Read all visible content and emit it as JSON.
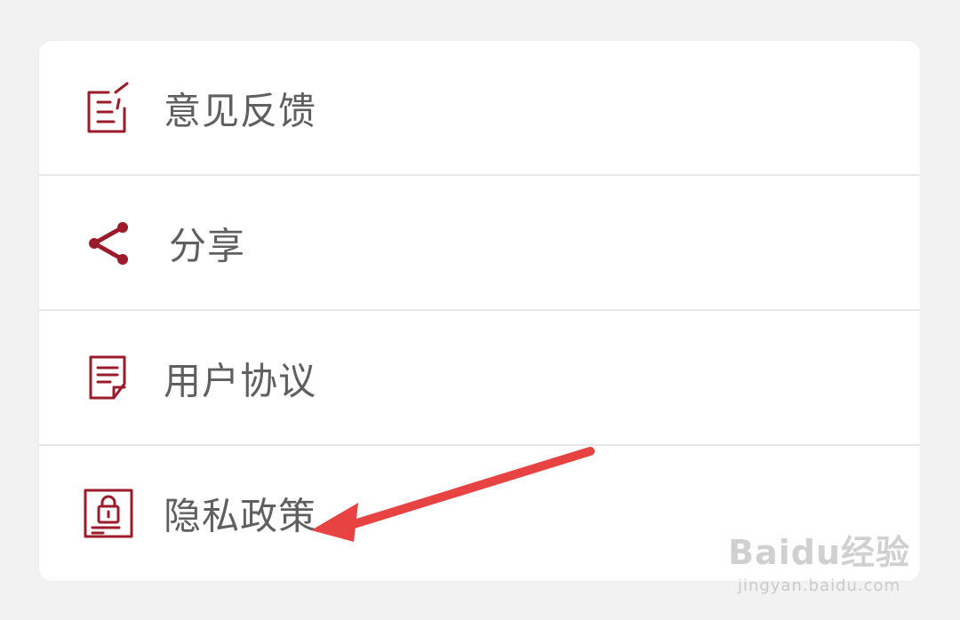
{
  "menu": {
    "items": [
      {
        "label": "意见反馈",
        "icon": "feedback-edit-icon"
      },
      {
        "label": "分享",
        "icon": "share-icon"
      },
      {
        "label": "用户协议",
        "icon": "document-icon"
      },
      {
        "label": "隐私政策",
        "icon": "privacy-lock-icon"
      }
    ]
  },
  "colors": {
    "icon": "#9b1b2a",
    "text": "#5f5f5f",
    "arrow": "#e84343",
    "background": "#f2f2f2",
    "card": "#ffffff",
    "divider": "#e8e8e8"
  },
  "watermark": {
    "main": "Baidu经验",
    "sub": "jingyan.baidu.com"
  }
}
